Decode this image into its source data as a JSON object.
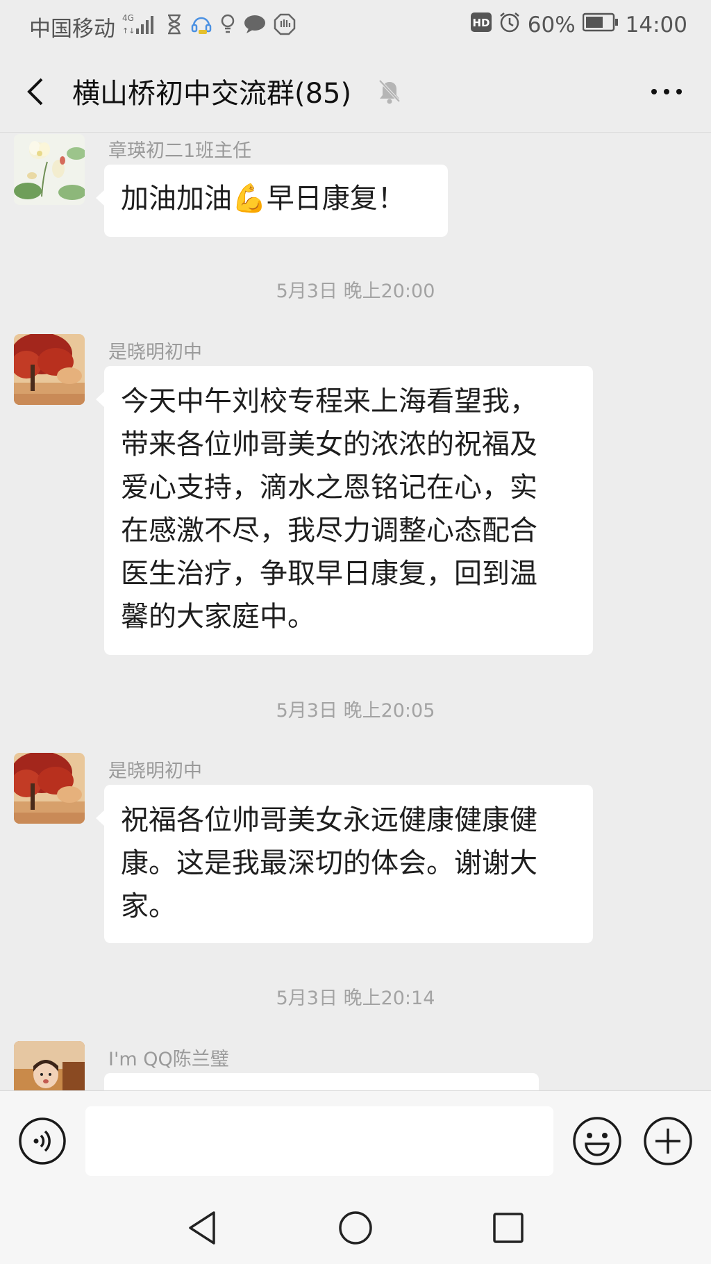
{
  "status_bar": {
    "carrier": "中国移动",
    "network": "4G",
    "hd_label": "HD",
    "battery": "60%",
    "time": "14:00"
  },
  "header": {
    "title": "横山桥初中交流群(85)"
  },
  "messages": [
    {
      "sender": "章瑛初二1班主任",
      "text": "加油加油💪早日康复！",
      "avatar": "lotus-avatar-icon"
    },
    {
      "timestamp": "5月3日 晚上20:00"
    },
    {
      "sender": "是晓明初中",
      "lines": [
        "今天中午刘校专程来上海看望我，",
        "带来各位帅哥美女的浓浓的祝福及",
        "爱心支持，滴水之恩铭记在心，实",
        "在感激不尽，我尽力调整心态配合",
        "医生治疗，争取早日康复，回到温",
        "馨的大家庭中。"
      ],
      "avatar": "red-tree-avatar-icon"
    },
    {
      "timestamp": "5月3日 晚上20:05"
    },
    {
      "sender": "是晓明初中",
      "lines": [
        "祝福各位帅哥美女永远健康健康健",
        "康。这是我最深切的体会。谢谢大",
        "家。"
      ],
      "avatar": "red-tree-avatar-icon"
    },
    {
      "timestamp": "5月3日 晚上20:14"
    },
    {
      "sender": "I'm QQ陈兰璧",
      "avatar": "child-photo-avatar-icon"
    }
  ],
  "input_bar": {
    "value": "",
    "icons": [
      "voice-icon",
      "emoji-icon",
      "plus-icon"
    ]
  },
  "nav_bar": {
    "icons": [
      "back-triangle-icon",
      "home-circle-icon",
      "recent-square-icon"
    ]
  },
  "colors": {
    "background": "#ededed",
    "bubble": "#ffffff",
    "meta_text": "#a3a3a3"
  }
}
